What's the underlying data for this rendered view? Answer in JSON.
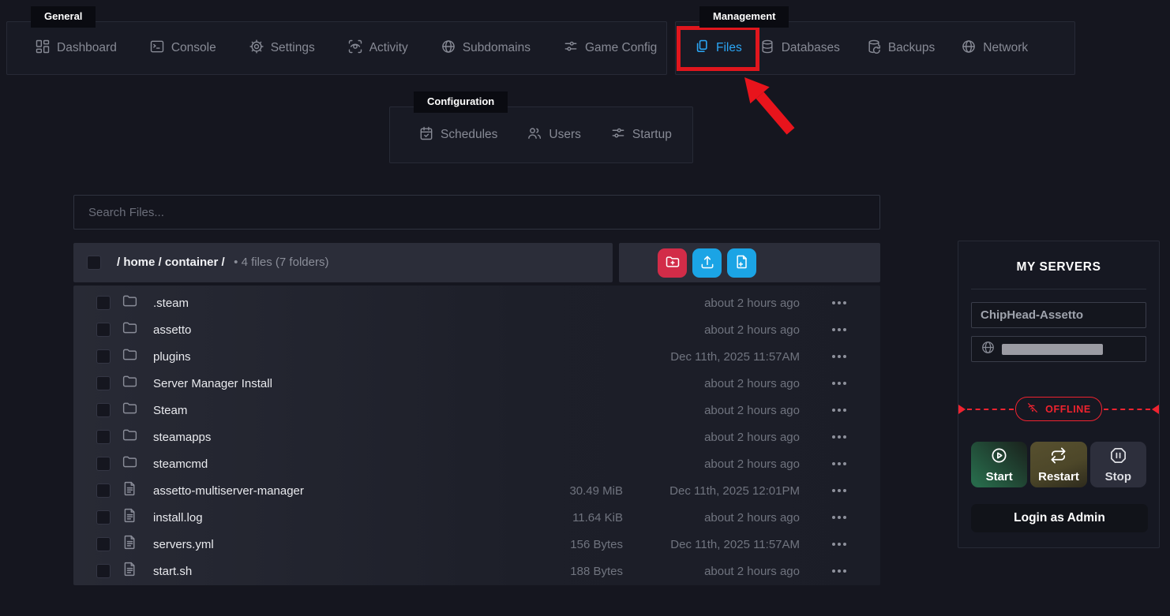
{
  "nav": {
    "general": {
      "label": "General",
      "items": [
        {
          "label": "Dashboard"
        },
        {
          "label": "Console"
        },
        {
          "label": "Settings"
        },
        {
          "label": "Activity"
        },
        {
          "label": "Subdomains"
        },
        {
          "label": "Game Config"
        }
      ]
    },
    "management": {
      "label": "Management",
      "items": [
        {
          "label": "Files",
          "active": true
        },
        {
          "label": "Databases"
        },
        {
          "label": "Backups"
        },
        {
          "label": "Network"
        }
      ]
    },
    "configuration": {
      "label": "Configuration",
      "items": [
        {
          "label": "Schedules"
        },
        {
          "label": "Users"
        },
        {
          "label": "Startup"
        }
      ]
    }
  },
  "file_manager": {
    "search_placeholder": "Search Files...",
    "breadcrumb": {
      "path": "/ home / container /",
      "summary": "• 4 files (7 folders)"
    },
    "rows": [
      {
        "type": "folder",
        "name": ".steam",
        "size": "",
        "modified": "about 2 hours ago"
      },
      {
        "type": "folder",
        "name": "assetto",
        "size": "",
        "modified": "about 2 hours ago"
      },
      {
        "type": "folder",
        "name": "plugins",
        "size": "",
        "modified": "Dec 11th, 2025 11:57AM"
      },
      {
        "type": "folder",
        "name": "Server Manager Install",
        "size": "",
        "modified": "about 2 hours ago"
      },
      {
        "type": "folder",
        "name": "Steam",
        "size": "",
        "modified": "about 2 hours ago"
      },
      {
        "type": "folder",
        "name": "steamapps",
        "size": "",
        "modified": "about 2 hours ago"
      },
      {
        "type": "folder",
        "name": "steamcmd",
        "size": "",
        "modified": "about 2 hours ago"
      },
      {
        "type": "file",
        "name": "assetto-multiserver-manager",
        "size": "30.49 MiB",
        "modified": "Dec 11th, 2025 12:01PM"
      },
      {
        "type": "file",
        "name": "install.log",
        "size": "11.64 KiB",
        "modified": "about 2 hours ago"
      },
      {
        "type": "file",
        "name": "servers.yml",
        "size": "156 Bytes",
        "modified": "Dec 11th, 2025 11:57AM"
      },
      {
        "type": "file",
        "name": "start.sh",
        "size": "188 Bytes",
        "modified": "about 2 hours ago"
      }
    ]
  },
  "sidebar": {
    "title": "MY SERVERS",
    "server_name": "ChipHead-Assetto",
    "status": "OFFLINE",
    "power": {
      "start": "Start",
      "restart": "Restart",
      "stop": "Stop"
    },
    "admin_button": "Login as Admin"
  },
  "colors": {
    "accent_blue": "#2ba6f5",
    "button_blue": "#1ba4e5",
    "button_red": "#d22c48",
    "highlight_red": "#e0161d",
    "status_red": "#ef2330",
    "start_green": "#27694a",
    "restart_olive": "#57502f",
    "page_bg": "#15161f"
  }
}
